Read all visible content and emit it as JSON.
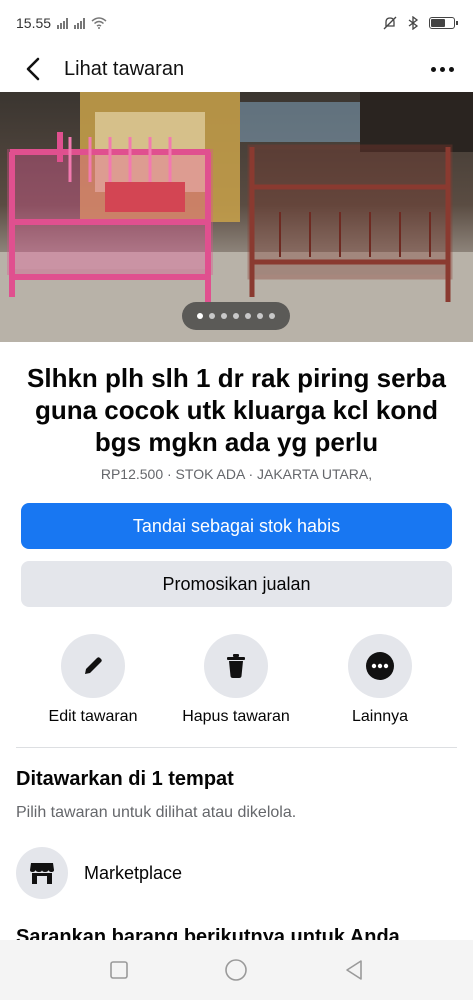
{
  "status_bar": {
    "time": "15.55",
    "icons": [
      "signal-x-icon",
      "signal-x-icon",
      "wifi-icon",
      "mute-icon",
      "bluetooth-icon",
      "battery-charging-icon"
    ]
  },
  "header": {
    "title": "Lihat tawaran",
    "back_icon": "back-arrow-icon",
    "more_icon": "more-dots-icon"
  },
  "gallery": {
    "image_count": 7,
    "active_index": 0
  },
  "listing": {
    "title": "Slhkn plh slh 1 dr rak piring serba guna cocok utk kluarga kcl kond bgs mgkn ada yg perlu",
    "meta": "RP12.500 · STOK ADA · JAKARTA UTARA,"
  },
  "buttons": {
    "mark_sold": "Tandai sebagai stok habis",
    "promote": "Promosikan jualan"
  },
  "actions": [
    {
      "label": "Edit tawaran",
      "icon": "pencil-icon"
    },
    {
      "label": "Hapus tawaran",
      "icon": "trash-icon"
    },
    {
      "label": "Lainnya",
      "icon": "more-circle-icon"
    }
  ],
  "offered": {
    "title": "Ditawarkan di 1 tempat",
    "subtitle": "Pilih tawaran untuk dilihat atau dikelola.",
    "places": [
      {
        "label": "Marketplace",
        "icon": "marketplace-shop-icon"
      }
    ]
  },
  "next_section_partial": "Sarankan barang berikutnya untuk Anda",
  "nav_bar": {
    "icons": [
      "recent-apps-icon",
      "home-icon",
      "back-triangle-icon"
    ]
  },
  "colors": {
    "primary": "#1877f2",
    "secondary_bg": "#e4e6eb",
    "muted_text": "#65676b",
    "text": "#050505"
  }
}
